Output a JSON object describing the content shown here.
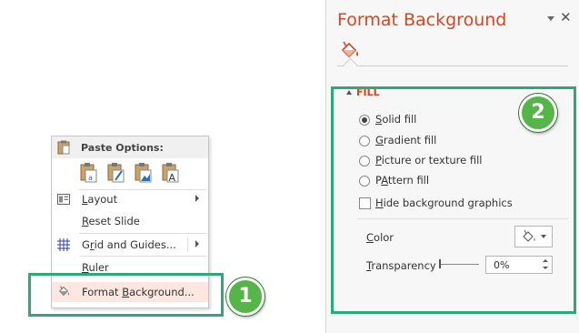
{
  "context_menu": {
    "paste_options_label": "Paste Options:",
    "paste_icons": [
      "paste-use-destination-theme-icon",
      "paste-keep-source-formatting-icon",
      "paste-picture-icon",
      "paste-keep-text-only-icon"
    ],
    "items": [
      {
        "name": "layout",
        "label": "Layout",
        "mnemonic": "L",
        "rest": "ayout",
        "submenu": true,
        "icon": "layout-icon"
      },
      {
        "name": "reset-slide",
        "label": "Reset Slide",
        "mnemonic": "R",
        "rest": "eset Slide",
        "submenu": false
      },
      {
        "name": "grid-and-guides",
        "label": "Grid and Guides...",
        "mnemonic": "r",
        "pre": "G",
        "rest": "id and Guides...",
        "submenu": true,
        "icon": "grid-icon"
      },
      {
        "name": "ruler",
        "label": "Ruler",
        "mnemonic": "R",
        "rest": "uler",
        "submenu": false
      },
      {
        "name": "format-background",
        "label": "Format Background...",
        "pre": "Format ",
        "mnemonic": "B",
        "rest": "ackground...",
        "submenu": false,
        "icon": "paint-bucket-icon",
        "highlighted": true
      }
    ]
  },
  "badges": {
    "one": "1",
    "two": "2"
  },
  "pane": {
    "title": "Format Background",
    "section_title": "FILL",
    "fill_options": [
      {
        "name": "solid-fill",
        "mnemonic": "S",
        "rest": "olid fill",
        "selected": true
      },
      {
        "name": "gradient-fill",
        "mnemonic": "G",
        "rest": "radient fill",
        "selected": false
      },
      {
        "name": "picture-or-texture-fill",
        "mnemonic": "P",
        "rest": "icture or texture fill",
        "selected": false
      },
      {
        "name": "pattern-fill",
        "mnemonic": "A",
        "pre": "P",
        "rest": "ttern fill",
        "selected": false
      }
    ],
    "hide_background_graphics": {
      "mnemonic": "H",
      "rest": "ide background graphics",
      "checked": false
    },
    "color_label": {
      "mnemonic": "C",
      "rest": "olor"
    },
    "transparency_label": {
      "mnemonic": "T",
      "rest": "ransparency"
    },
    "transparency_value": "0%"
  },
  "colors": {
    "accent": "#d24726",
    "highlight_border": "#2ea77a",
    "badge": "#56b549"
  }
}
